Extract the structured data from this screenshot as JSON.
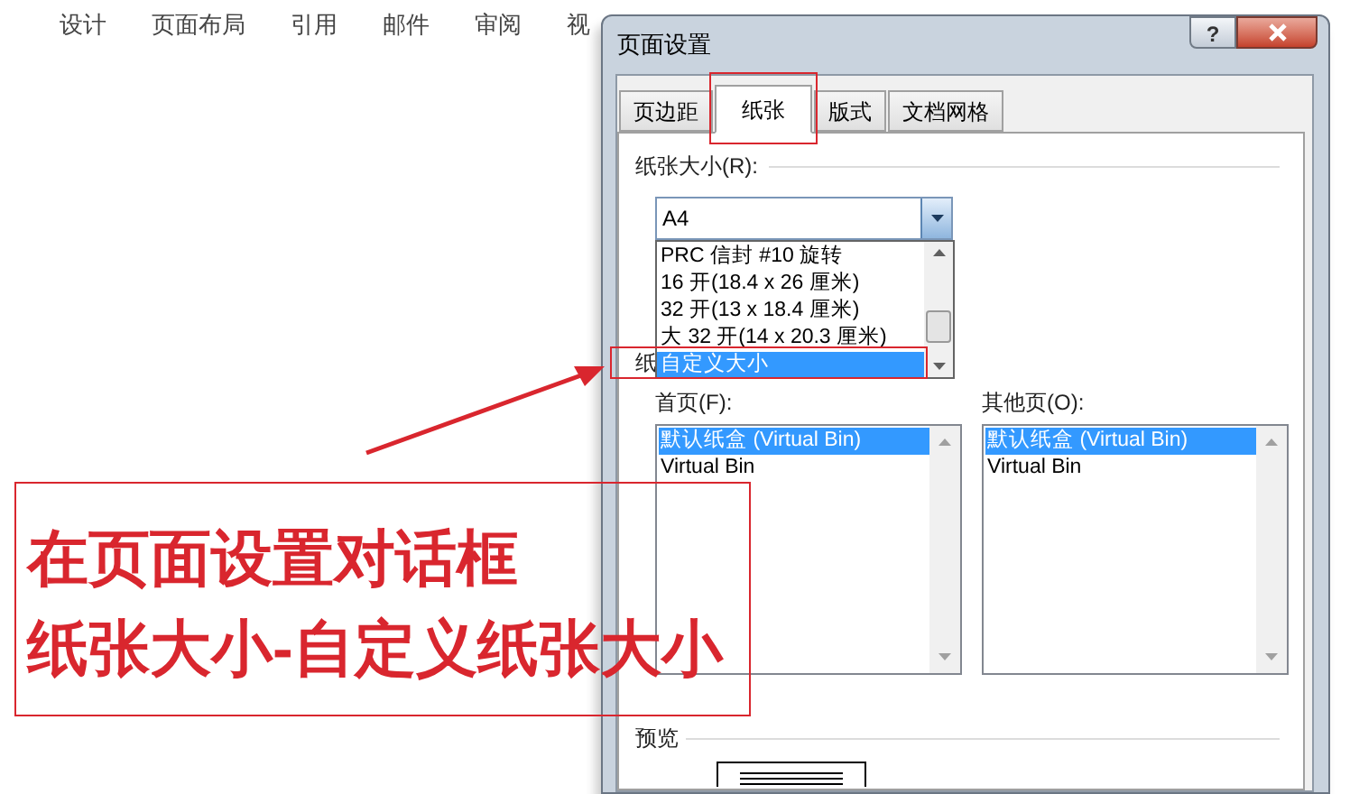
{
  "ribbon": {
    "tabs": [
      {
        "label": "设计"
      },
      {
        "label": "页面布局"
      },
      {
        "label": "引用"
      },
      {
        "label": "邮件"
      },
      {
        "label": "审阅"
      },
      {
        "label": "视"
      }
    ]
  },
  "dialog": {
    "title": "页面设置",
    "help_button": "?",
    "tabs": [
      {
        "label": "页边距",
        "selected": false
      },
      {
        "label": "纸张",
        "selected": true
      },
      {
        "label": "版式",
        "selected": false
      },
      {
        "label": "文档网格",
        "selected": false
      }
    ],
    "paper_size": {
      "label": "纸张大小(R):",
      "value": "A4",
      "options": [
        {
          "label": "PRC 信封 #10 旋转",
          "selected": false
        },
        {
          "label": "16 开(18.4 x 26 厘米)",
          "selected": false
        },
        {
          "label": "32 开(13 x 18.4 厘米)",
          "selected": false
        },
        {
          "label": "大 32 开(14 x 20.3 厘米)",
          "selected": false
        },
        {
          "label": "自定义大小",
          "selected": true
        }
      ]
    },
    "paper_source_label": "纸",
    "trays": [
      {
        "label": "首页(F):",
        "items": [
          {
            "label": "默认纸盒 (Virtual Bin)",
            "selected": true
          },
          {
            "label": "Virtual Bin",
            "selected": false
          }
        ]
      },
      {
        "label": "其他页(O):",
        "items": [
          {
            "label": "默认纸盒 (Virtual Bin)",
            "selected": true
          },
          {
            "label": "Virtual Bin",
            "selected": false
          }
        ]
      }
    ],
    "preview_label": "预览"
  },
  "annotation": {
    "lines": [
      "在页面设置对话框",
      "纸张大小-自定义纸张大小"
    ]
  }
}
